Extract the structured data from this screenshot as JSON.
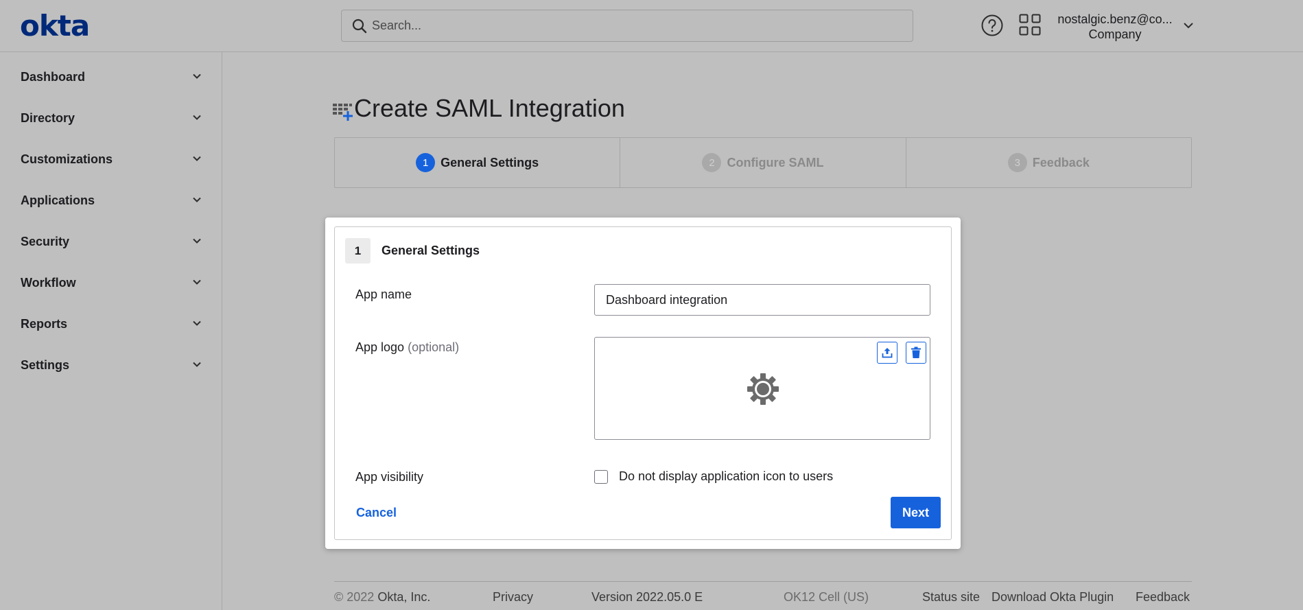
{
  "brand": {
    "logo_text": "okta",
    "accent_color": "#1662dd",
    "logo_color": "#00297a"
  },
  "header": {
    "search_placeholder": "Search...",
    "help_icon": "help-circle-icon",
    "apps_icon": "app-grid-icon",
    "user_email": "nostalgic.benz@co...",
    "user_org": "Company"
  },
  "sidebar": {
    "items": [
      {
        "label": "Dashboard"
      },
      {
        "label": "Directory"
      },
      {
        "label": "Customizations"
      },
      {
        "label": "Applications"
      },
      {
        "label": "Security"
      },
      {
        "label": "Workflow"
      },
      {
        "label": "Reports"
      },
      {
        "label": "Settings"
      }
    ]
  },
  "main": {
    "title": "Create SAML Integration",
    "steps": [
      {
        "num": "1",
        "label": "General Settings",
        "state": "active"
      },
      {
        "num": "2",
        "label": "Configure SAML",
        "state": "inactive"
      },
      {
        "num": "3",
        "label": "Feedback",
        "state": "inactive"
      }
    ]
  },
  "card": {
    "step_num": "1",
    "title": "General Settings",
    "app_name_label": "App name",
    "app_name_value": "Dashboard integration",
    "app_logo_label": "App logo",
    "app_logo_optional": "(optional)",
    "app_visibility_label": "App visibility",
    "visibility_checkbox_label": "Do not display application icon to users",
    "visibility_checked": false,
    "cancel_label": "Cancel",
    "next_label": "Next"
  },
  "footer": {
    "copyright_symbol": "© 2022",
    "copyright_company": "Okta, Inc.",
    "privacy": "Privacy",
    "version": "Version 2022.05.0 E",
    "cell": "OK12 Cell (US)",
    "status_site": "Status site",
    "download_plugin": "Download Okta Plugin",
    "feedback": "Feedback"
  }
}
